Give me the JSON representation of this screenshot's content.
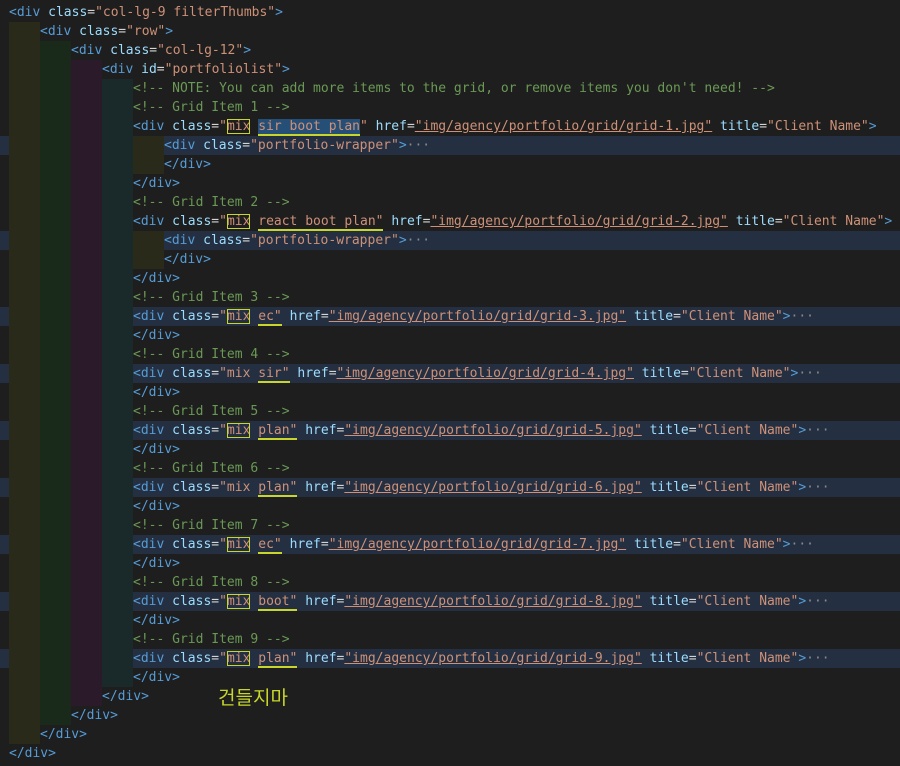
{
  "colors": {
    "background": "#1e1e1e",
    "tag": "#569cd6",
    "attribute": "#9cdcfe",
    "string": "#ce9178",
    "comment": "#6a9955",
    "annotation": "#c8d62a",
    "line_highlight": "#243041"
  },
  "annotation_text": "건들지마",
  "lines": [
    {
      "indent": 0,
      "hl": false,
      "tokens": [
        {
          "t": "<div ",
          "c": "tag"
        },
        {
          "t": "class",
          "c": "attr"
        },
        {
          "t": "=",
          "c": "txt"
        },
        {
          "t": "\"col-lg-9 filterThumbs\"",
          "c": "str"
        },
        {
          "t": ">",
          "c": "tag"
        }
      ]
    },
    {
      "indent": 1,
      "hl": false,
      "tokens": [
        {
          "t": "<div ",
          "c": "tag"
        },
        {
          "t": "class",
          "c": "attr"
        },
        {
          "t": "=",
          "c": "txt"
        },
        {
          "t": "\"row\"",
          "c": "str"
        },
        {
          "t": ">",
          "c": "tag"
        }
      ]
    },
    {
      "indent": 2,
      "hl": false,
      "tokens": [
        {
          "t": "<div ",
          "c": "tag"
        },
        {
          "t": "class",
          "c": "attr"
        },
        {
          "t": "=",
          "c": "txt"
        },
        {
          "t": "\"col-lg-12\"",
          "c": "str"
        },
        {
          "t": ">",
          "c": "tag"
        }
      ]
    },
    {
      "indent": 3,
      "hl": false,
      "tokens": [
        {
          "t": "<div ",
          "c": "tag"
        },
        {
          "t": "id",
          "c": "attr"
        },
        {
          "t": "=",
          "c": "txt"
        },
        {
          "t": "\"portfoliolist\"",
          "c": "str"
        },
        {
          "t": ">",
          "c": "tag"
        }
      ]
    },
    {
      "indent": 4,
      "hl": false,
      "tokens": [
        {
          "t": "<!-- NOTE: You can add more items to the grid, or remove items you don't need! -->",
          "c": "cmt"
        }
      ]
    },
    {
      "indent": 4,
      "hl": false,
      "tokens": [
        {
          "t": "<!-- Grid Item 1 -->",
          "c": "cmt"
        }
      ]
    },
    {
      "indent": 4,
      "hl": false,
      "tokens": [
        {
          "t": "<div ",
          "c": "tag"
        },
        {
          "t": "class",
          "c": "attr"
        },
        {
          "t": "=",
          "c": "txt"
        },
        {
          "t": "\"",
          "c": "str"
        },
        {
          "t": "mix",
          "c": "str",
          "box": true
        },
        {
          "t": " ",
          "c": "str"
        },
        {
          "t": "sir boot plan",
          "c": "str",
          "uline": true,
          "sel": true
        },
        {
          "t": "\"",
          "c": "str"
        },
        {
          "t": " ",
          "c": "txt"
        },
        {
          "t": "href",
          "c": "attr"
        },
        {
          "t": "=",
          "c": "txt"
        },
        {
          "t": "\"img/agency/portfolio/grid/grid-1.jpg\"",
          "c": "str",
          "url": true
        },
        {
          "t": " ",
          "c": "txt"
        },
        {
          "t": "title",
          "c": "attr"
        },
        {
          "t": "=",
          "c": "txt"
        },
        {
          "t": "\"Client Name\"",
          "c": "str"
        },
        {
          "t": ">",
          "c": "tag"
        }
      ]
    },
    {
      "indent": 5,
      "hl": true,
      "tokens": [
        {
          "t": "<div ",
          "c": "tag"
        },
        {
          "t": "class",
          "c": "attr"
        },
        {
          "t": "=",
          "c": "txt"
        },
        {
          "t": "\"portfolio-wrapper\"",
          "c": "str"
        },
        {
          "t": ">",
          "c": "tag"
        },
        {
          "t": "···",
          "c": "ell"
        }
      ]
    },
    {
      "indent": 5,
      "hl": false,
      "tokens": [
        {
          "t": "</div>",
          "c": "tag"
        }
      ]
    },
    {
      "indent": 4,
      "hl": false,
      "tokens": [
        {
          "t": "</div>",
          "c": "tag"
        }
      ]
    },
    {
      "indent": 4,
      "hl": false,
      "tokens": [
        {
          "t": "<!-- Grid Item 2 -->",
          "c": "cmt"
        }
      ]
    },
    {
      "indent": 4,
      "hl": false,
      "tokens": [
        {
          "t": "<div ",
          "c": "tag"
        },
        {
          "t": "class",
          "c": "attr"
        },
        {
          "t": "=",
          "c": "txt"
        },
        {
          "t": "\"",
          "c": "str"
        },
        {
          "t": "mix",
          "c": "str",
          "box": true
        },
        {
          "t": " ",
          "c": "str"
        },
        {
          "t": "react boot plan\"",
          "c": "str",
          "uline": true
        },
        {
          "t": " ",
          "c": "txt"
        },
        {
          "t": "href",
          "c": "attr"
        },
        {
          "t": "=",
          "c": "txt"
        },
        {
          "t": "\"img/agency/portfolio/grid/grid-2.jpg\"",
          "c": "str",
          "url": true
        },
        {
          "t": " ",
          "c": "txt"
        },
        {
          "t": "title",
          "c": "attr"
        },
        {
          "t": "=",
          "c": "txt"
        },
        {
          "t": "\"Client Name\"",
          "c": "str"
        },
        {
          "t": ">",
          "c": "tag"
        }
      ]
    },
    {
      "indent": 5,
      "hl": true,
      "tokens": [
        {
          "t": "<div ",
          "c": "tag"
        },
        {
          "t": "class",
          "c": "attr"
        },
        {
          "t": "=",
          "c": "txt"
        },
        {
          "t": "\"portfolio-wrapper\"",
          "c": "str"
        },
        {
          "t": ">",
          "c": "tag"
        },
        {
          "t": "···",
          "c": "ell"
        }
      ]
    },
    {
      "indent": 5,
      "hl": false,
      "tokens": [
        {
          "t": "</div>",
          "c": "tag"
        }
      ]
    },
    {
      "indent": 4,
      "hl": false,
      "tokens": [
        {
          "t": "</div>",
          "c": "tag"
        }
      ]
    },
    {
      "indent": 4,
      "hl": false,
      "tokens": [
        {
          "t": "<!-- Grid Item 3 -->",
          "c": "cmt"
        }
      ]
    },
    {
      "indent": 4,
      "hl": true,
      "tokens": [
        {
          "t": "<div ",
          "c": "tag"
        },
        {
          "t": "class",
          "c": "attr"
        },
        {
          "t": "=",
          "c": "txt"
        },
        {
          "t": "\"",
          "c": "str"
        },
        {
          "t": "mix",
          "c": "str",
          "box": true
        },
        {
          "t": " ",
          "c": "str"
        },
        {
          "t": "ec\"",
          "c": "str",
          "uline": true
        },
        {
          "t": " ",
          "c": "txt"
        },
        {
          "t": "href",
          "c": "attr"
        },
        {
          "t": "=",
          "c": "txt"
        },
        {
          "t": "\"img/agency/portfolio/grid/grid-3.jpg\"",
          "c": "str",
          "url": true
        },
        {
          "t": " ",
          "c": "txt"
        },
        {
          "t": "title",
          "c": "attr"
        },
        {
          "t": "=",
          "c": "txt"
        },
        {
          "t": "\"Client Name\"",
          "c": "str"
        },
        {
          "t": ">",
          "c": "tag"
        },
        {
          "t": "···",
          "c": "ell"
        }
      ]
    },
    {
      "indent": 4,
      "hl": false,
      "tokens": [
        {
          "t": "</div>",
          "c": "tag"
        }
      ]
    },
    {
      "indent": 4,
      "hl": false,
      "tokens": [
        {
          "t": "<!-- Grid Item 4 -->",
          "c": "cmt"
        }
      ]
    },
    {
      "indent": 4,
      "hl": true,
      "tokens": [
        {
          "t": "<div ",
          "c": "tag"
        },
        {
          "t": "class",
          "c": "attr"
        },
        {
          "t": "=",
          "c": "txt"
        },
        {
          "t": "\"mix ",
          "c": "str"
        },
        {
          "t": "sir\"",
          "c": "str",
          "uline": true
        },
        {
          "t": " ",
          "c": "txt"
        },
        {
          "t": "href",
          "c": "attr"
        },
        {
          "t": "=",
          "c": "txt"
        },
        {
          "t": "\"img/agency/portfolio/grid/grid-4.jpg\"",
          "c": "str",
          "url": true
        },
        {
          "t": " ",
          "c": "txt"
        },
        {
          "t": "title",
          "c": "attr"
        },
        {
          "t": "=",
          "c": "txt"
        },
        {
          "t": "\"Client Name\"",
          "c": "str"
        },
        {
          "t": ">",
          "c": "tag"
        },
        {
          "t": "···",
          "c": "ell"
        }
      ]
    },
    {
      "indent": 4,
      "hl": false,
      "tokens": [
        {
          "t": "</div>",
          "c": "tag"
        }
      ]
    },
    {
      "indent": 4,
      "hl": false,
      "tokens": [
        {
          "t": "<!-- Grid Item 5 -->",
          "c": "cmt"
        }
      ]
    },
    {
      "indent": 4,
      "hl": true,
      "tokens": [
        {
          "t": "<div ",
          "c": "tag"
        },
        {
          "t": "class",
          "c": "attr"
        },
        {
          "t": "=",
          "c": "txt"
        },
        {
          "t": "\"",
          "c": "str"
        },
        {
          "t": "mix",
          "c": "str",
          "box": true
        },
        {
          "t": " ",
          "c": "str"
        },
        {
          "t": "plan\"",
          "c": "str",
          "uline": true
        },
        {
          "t": " ",
          "c": "txt"
        },
        {
          "t": "href",
          "c": "attr"
        },
        {
          "t": "=",
          "c": "txt"
        },
        {
          "t": "\"img/agency/portfolio/grid/grid-5.jpg\"",
          "c": "str",
          "url": true
        },
        {
          "t": " ",
          "c": "txt"
        },
        {
          "t": "title",
          "c": "attr"
        },
        {
          "t": "=",
          "c": "txt"
        },
        {
          "t": "\"Client Name\"",
          "c": "str"
        },
        {
          "t": ">",
          "c": "tag"
        },
        {
          "t": "···",
          "c": "ell"
        }
      ]
    },
    {
      "indent": 4,
      "hl": false,
      "tokens": [
        {
          "t": "</div>",
          "c": "tag"
        }
      ]
    },
    {
      "indent": 4,
      "hl": false,
      "tokens": [
        {
          "t": "<!-- Grid Item 6 -->",
          "c": "cmt"
        }
      ]
    },
    {
      "indent": 4,
      "hl": true,
      "tokens": [
        {
          "t": "<div ",
          "c": "tag"
        },
        {
          "t": "class",
          "c": "attr"
        },
        {
          "t": "=",
          "c": "txt"
        },
        {
          "t": "\"mix ",
          "c": "str"
        },
        {
          "t": "plan\"",
          "c": "str",
          "uline": true
        },
        {
          "t": " ",
          "c": "txt"
        },
        {
          "t": "href",
          "c": "attr"
        },
        {
          "t": "=",
          "c": "txt"
        },
        {
          "t": "\"img/agency/portfolio/grid/grid-6.jpg\"",
          "c": "str",
          "url": true
        },
        {
          "t": " ",
          "c": "txt"
        },
        {
          "t": "title",
          "c": "attr"
        },
        {
          "t": "=",
          "c": "txt"
        },
        {
          "t": "\"Client Name\"",
          "c": "str"
        },
        {
          "t": ">",
          "c": "tag"
        },
        {
          "t": "···",
          "c": "ell"
        }
      ]
    },
    {
      "indent": 4,
      "hl": false,
      "tokens": [
        {
          "t": "</div>",
          "c": "tag"
        }
      ]
    },
    {
      "indent": 4,
      "hl": false,
      "tokens": [
        {
          "t": "<!-- Grid Item 7 -->",
          "c": "cmt"
        }
      ]
    },
    {
      "indent": 4,
      "hl": true,
      "tokens": [
        {
          "t": "<div ",
          "c": "tag"
        },
        {
          "t": "class",
          "c": "attr"
        },
        {
          "t": "=",
          "c": "txt"
        },
        {
          "t": "\"",
          "c": "str"
        },
        {
          "t": "mix",
          "c": "str",
          "box": true
        },
        {
          "t": " ",
          "c": "str"
        },
        {
          "t": "ec\"",
          "c": "str",
          "uline": true
        },
        {
          "t": " ",
          "c": "txt"
        },
        {
          "t": "href",
          "c": "attr"
        },
        {
          "t": "=",
          "c": "txt"
        },
        {
          "t": "\"img/agency/portfolio/grid/grid-7.jpg\"",
          "c": "str",
          "url": true
        },
        {
          "t": " ",
          "c": "txt"
        },
        {
          "t": "title",
          "c": "attr"
        },
        {
          "t": "=",
          "c": "txt"
        },
        {
          "t": "\"Client Name\"",
          "c": "str"
        },
        {
          "t": ">",
          "c": "tag"
        },
        {
          "t": "···",
          "c": "ell"
        }
      ]
    },
    {
      "indent": 4,
      "hl": false,
      "tokens": [
        {
          "t": "</div>",
          "c": "tag"
        }
      ]
    },
    {
      "indent": 4,
      "hl": false,
      "tokens": [
        {
          "t": "<!-- Grid Item 8 -->",
          "c": "cmt"
        }
      ]
    },
    {
      "indent": 4,
      "hl": true,
      "tokens": [
        {
          "t": "<div ",
          "c": "tag"
        },
        {
          "t": "class",
          "c": "attr"
        },
        {
          "t": "=",
          "c": "txt"
        },
        {
          "t": "\"",
          "c": "str"
        },
        {
          "t": "mix",
          "c": "str",
          "box": true
        },
        {
          "t": " ",
          "c": "str"
        },
        {
          "t": "boot\"",
          "c": "str",
          "uline": true
        },
        {
          "t": " ",
          "c": "txt"
        },
        {
          "t": "href",
          "c": "attr"
        },
        {
          "t": "=",
          "c": "txt"
        },
        {
          "t": "\"img/agency/portfolio/grid/grid-8.jpg\"",
          "c": "str",
          "url": true
        },
        {
          "t": " ",
          "c": "txt"
        },
        {
          "t": "title",
          "c": "attr"
        },
        {
          "t": "=",
          "c": "txt"
        },
        {
          "t": "\"Client Name\"",
          "c": "str"
        },
        {
          "t": ">",
          "c": "tag"
        },
        {
          "t": "···",
          "c": "ell"
        }
      ]
    },
    {
      "indent": 4,
      "hl": false,
      "tokens": [
        {
          "t": "</div>",
          "c": "tag"
        }
      ]
    },
    {
      "indent": 4,
      "hl": false,
      "tokens": [
        {
          "t": "<!-- Grid Item 9 -->",
          "c": "cmt"
        }
      ]
    },
    {
      "indent": 4,
      "hl": true,
      "tokens": [
        {
          "t": "<div ",
          "c": "tag"
        },
        {
          "t": "class",
          "c": "attr"
        },
        {
          "t": "=",
          "c": "txt"
        },
        {
          "t": "\"",
          "c": "str"
        },
        {
          "t": "mix",
          "c": "str",
          "box": true
        },
        {
          "t": " ",
          "c": "str"
        },
        {
          "t": "plan\"",
          "c": "str",
          "uline": true
        },
        {
          "t": " ",
          "c": "txt"
        },
        {
          "t": "href",
          "c": "attr"
        },
        {
          "t": "=",
          "c": "txt"
        },
        {
          "t": "\"img/agency/portfolio/grid/grid-9.jpg\"",
          "c": "str",
          "url": true
        },
        {
          "t": " ",
          "c": "txt"
        },
        {
          "t": "title",
          "c": "attr"
        },
        {
          "t": "=",
          "c": "txt"
        },
        {
          "t": "\"Client Name\"",
          "c": "str"
        },
        {
          "t": ">",
          "c": "tag"
        },
        {
          "t": "···",
          "c": "ell"
        }
      ]
    },
    {
      "indent": 4,
      "hl": false,
      "tokens": [
        {
          "t": "</div>",
          "c": "tag"
        }
      ]
    },
    {
      "indent": 3,
      "hl": false,
      "tokens": [
        {
          "t": "</div>",
          "c": "tag"
        }
      ]
    },
    {
      "indent": 2,
      "hl": false,
      "tokens": [
        {
          "t": "</div>",
          "c": "tag"
        }
      ]
    },
    {
      "indent": 1,
      "hl": false,
      "tokens": [
        {
          "t": "</div>",
          "c": "tag"
        }
      ]
    },
    {
      "indent": 0,
      "hl": false,
      "tokens": [
        {
          "t": "</div>",
          "c": "tag"
        }
      ]
    }
  ]
}
